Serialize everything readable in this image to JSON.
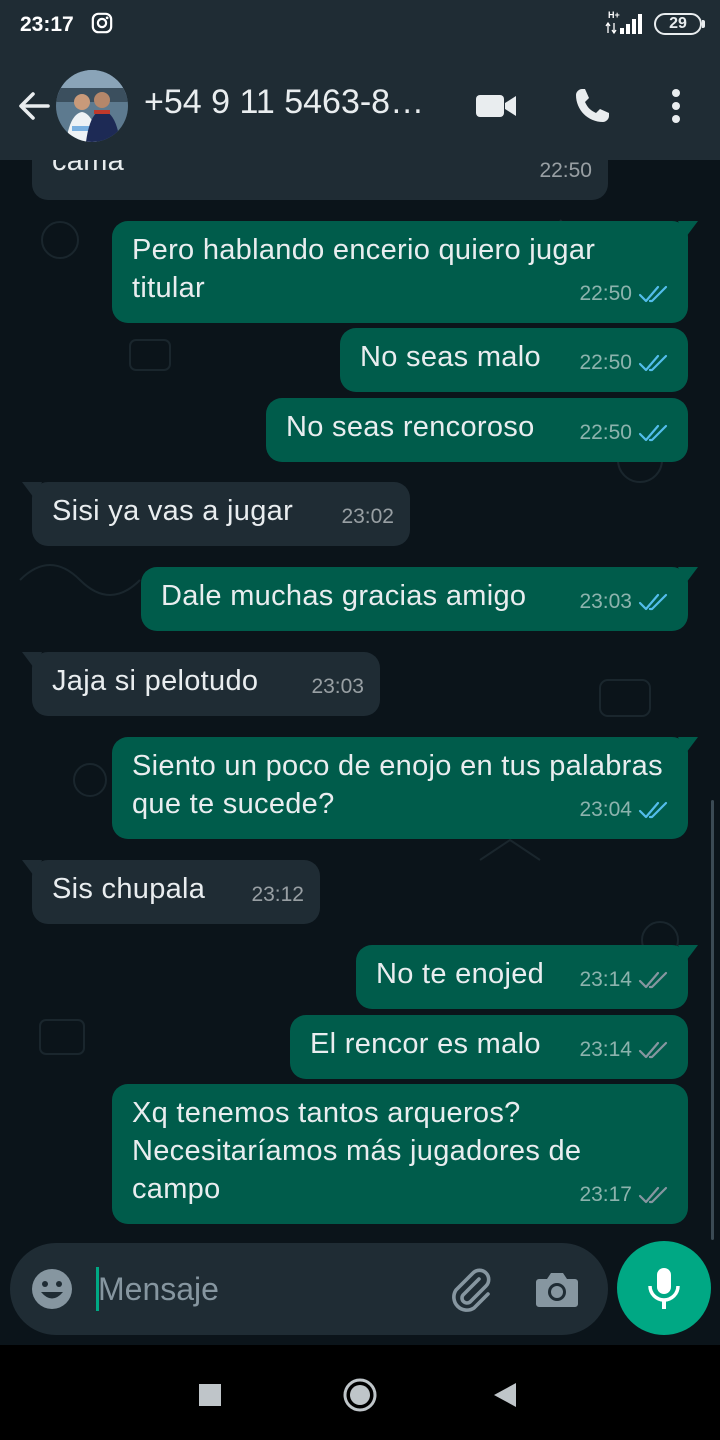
{
  "status_bar": {
    "time": "23:17",
    "network": "H+",
    "battery": "29"
  },
  "header": {
    "contact": "+54 9 11 5463-8…"
  },
  "messages": [
    {
      "dir": "in",
      "text": "cama",
      "time": "22:50",
      "read": false
    },
    {
      "dir": "out",
      "text": "Pero hablando encerio quiero jugar titular",
      "time": "22:50",
      "read": true
    },
    {
      "dir": "out",
      "text": "No seas malo",
      "time": "22:50",
      "read": true
    },
    {
      "dir": "out",
      "text": "No seas rencoroso",
      "time": "22:50",
      "read": true
    },
    {
      "dir": "in",
      "text": "Sisi ya vas a jugar",
      "time": "23:02",
      "read": false
    },
    {
      "dir": "out",
      "text": "Dale muchas gracias amigo",
      "time": "23:03",
      "read": true
    },
    {
      "dir": "in",
      "text": "Jaja si pelotudo",
      "time": "23:03",
      "read": false
    },
    {
      "dir": "out",
      "text": "Siento un poco de enojo en tus palabras que te sucede?",
      "time": "23:04",
      "read": true
    },
    {
      "dir": "in",
      "text": "Sis chupala",
      "time": "23:12",
      "read": false
    },
    {
      "dir": "out",
      "text": "No te enojed",
      "time": "23:14",
      "read": false
    },
    {
      "dir": "out",
      "text": "El rencor es malo",
      "time": "23:14",
      "read": false
    },
    {
      "dir": "out",
      "text": "Xq tenemos tantos arqueros? Necesitaríamos más jugadores de campo",
      "time": "23:17",
      "read": false
    }
  ],
  "composer": {
    "placeholder": "Mensaje"
  },
  "colors": {
    "background": "#0b141a",
    "bar": "#1f2c34",
    "outgoing": "#005c4b",
    "incoming": "#1f2c34",
    "accent": "#00a884",
    "read_tick": "#53bdeb",
    "unread_tick": "#8696a0"
  },
  "icons": [
    "instagram-icon",
    "signal-icon",
    "back-arrow-icon",
    "video-call-icon",
    "phone-icon",
    "more-vert-icon",
    "emoji-icon",
    "attach-icon",
    "camera-icon",
    "mic-icon",
    "nav-recents-icon",
    "nav-home-icon",
    "nav-back-icon"
  ]
}
